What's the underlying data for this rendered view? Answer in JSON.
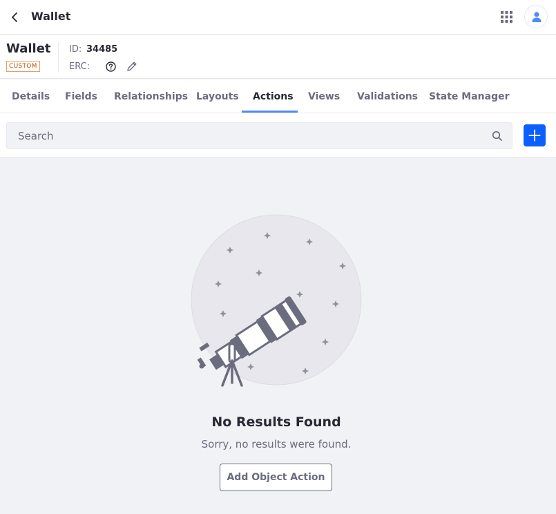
{
  "topbar": {
    "back_icon": "chevron-left-icon",
    "title": "Wallet",
    "apps_icon": "grid-icon",
    "avatar_icon": "user-icon"
  },
  "header": {
    "object_name": "Wallet",
    "badge": "CUSTOM",
    "id_label": "ID:",
    "id_value": "34485",
    "erc_label": "ERC:",
    "help_icon": "question-circle-icon",
    "edit_icon": "pencil-icon"
  },
  "tabs": [
    {
      "label": "Details"
    },
    {
      "label": "Fields"
    },
    {
      "label": "Relationships"
    },
    {
      "label": "Layouts"
    },
    {
      "label": "Actions",
      "active": true
    },
    {
      "label": "Views"
    },
    {
      "label": "Validations"
    },
    {
      "label": "State Manager"
    }
  ],
  "toolbar": {
    "search_placeholder": "Search",
    "search_value": "",
    "search_icon": "search-icon",
    "add_icon": "plus-icon"
  },
  "empty_state": {
    "illustration": "telescope-stars-illustration",
    "title": "No Results Found",
    "description": "Sorry, no results were found.",
    "button_label": "Add Object Action"
  },
  "colors": {
    "accent": "#0b5fff",
    "tab_underline": "#528bf5",
    "badge_text": "#b95000",
    "page_background": "#f1f2f5"
  }
}
